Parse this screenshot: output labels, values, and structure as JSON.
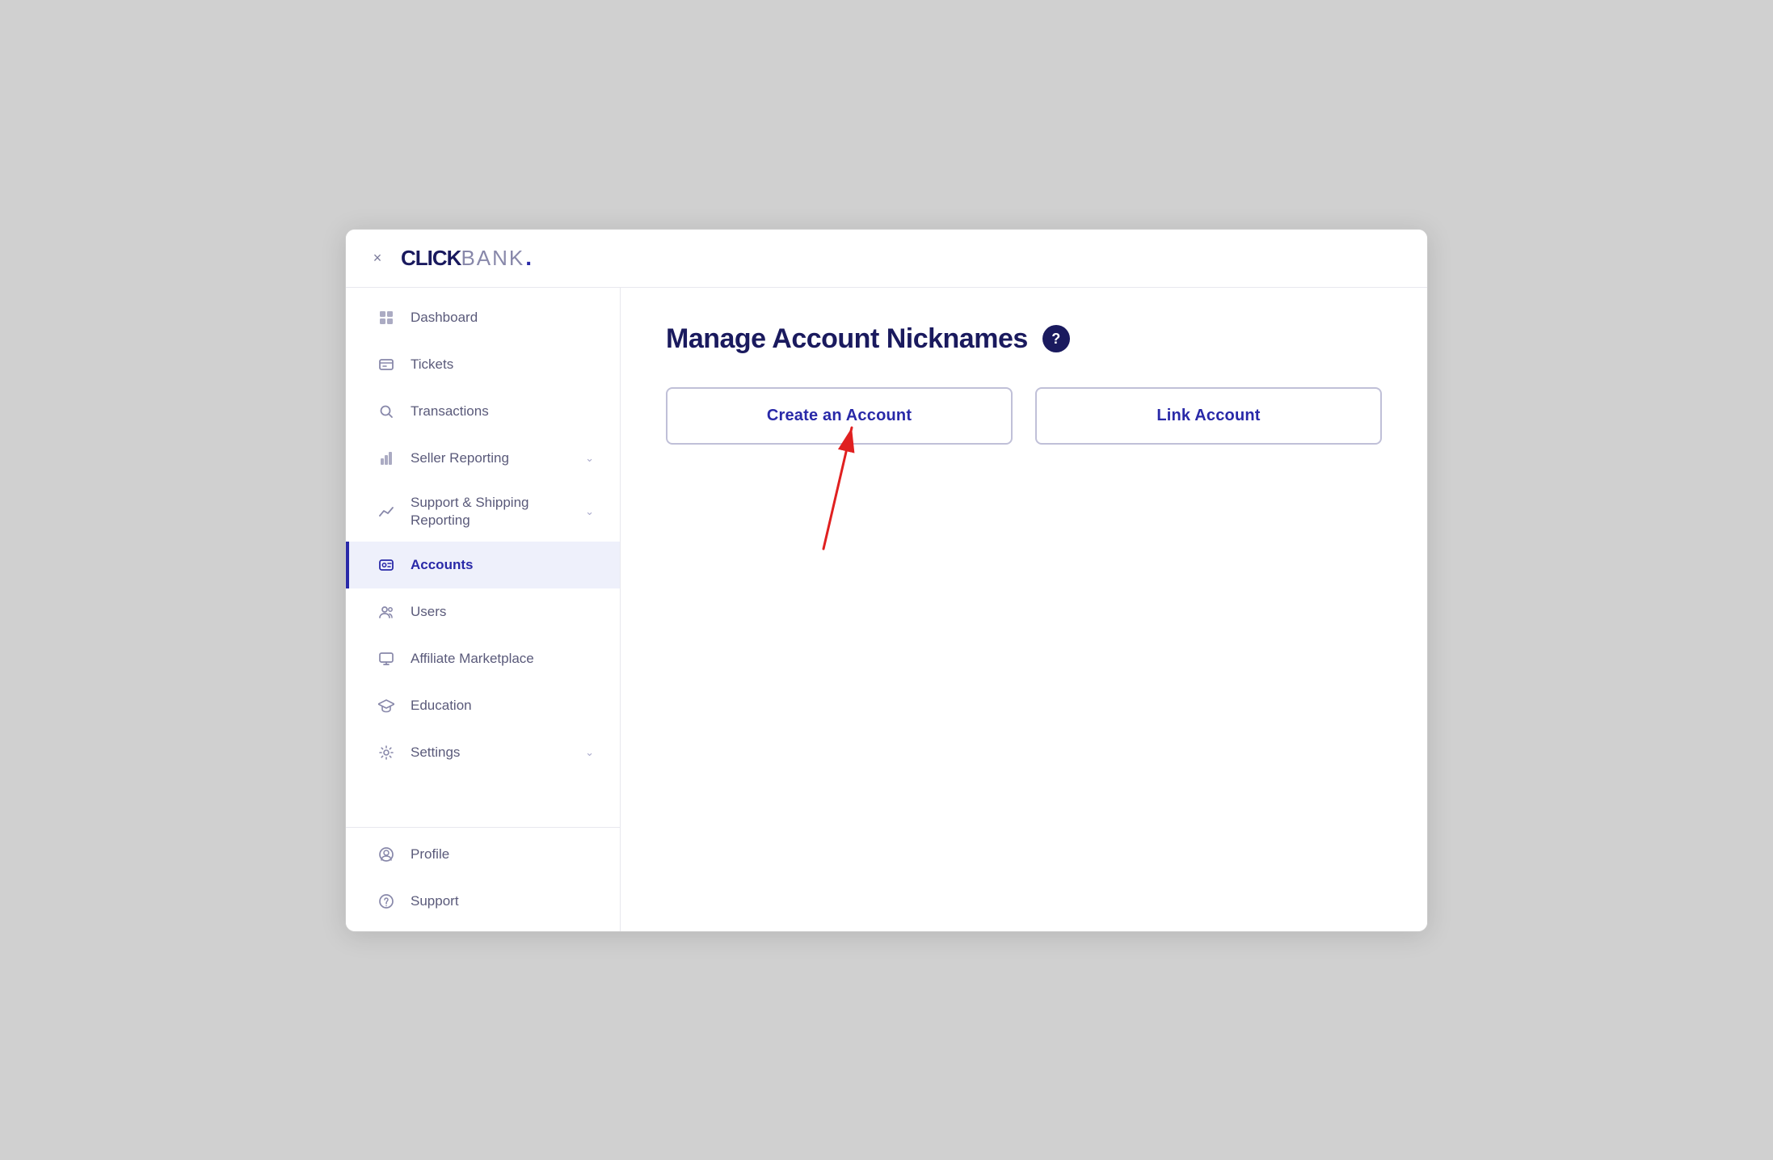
{
  "header": {
    "logo_click": "CLICK",
    "logo_bank": "BANK",
    "logo_dot": ".",
    "close_label": "×"
  },
  "sidebar": {
    "items": [
      {
        "id": "dashboard",
        "label": "Dashboard",
        "icon": "grid"
      },
      {
        "id": "tickets",
        "label": "Tickets",
        "icon": "ticket"
      },
      {
        "id": "transactions",
        "label": "Transactions",
        "icon": "search"
      },
      {
        "id": "seller-reporting",
        "label": "Seller Reporting",
        "icon": "bar-chart",
        "hasChevron": true
      },
      {
        "id": "support-shipping",
        "label": "Support & Shipping Reporting",
        "icon": "trending-up",
        "hasChevron": true
      },
      {
        "id": "accounts",
        "label": "Accounts",
        "icon": "user-card",
        "active": true
      },
      {
        "id": "users",
        "label": "Users",
        "icon": "users"
      },
      {
        "id": "affiliate-marketplace",
        "label": "Affiliate Marketplace",
        "icon": "monitor"
      },
      {
        "id": "education",
        "label": "Education",
        "icon": "graduation"
      },
      {
        "id": "settings",
        "label": "Settings",
        "icon": "gear",
        "hasChevron": true
      }
    ],
    "bottom_items": [
      {
        "id": "profile",
        "label": "Profile",
        "icon": "profile-circle"
      },
      {
        "id": "support",
        "label": "Support",
        "icon": "help-circle"
      }
    ]
  },
  "main": {
    "page_title": "Manage Account Nicknames",
    "help_icon_label": "?",
    "create_account_label": "Create an Account",
    "link_account_label": "Link Account"
  }
}
